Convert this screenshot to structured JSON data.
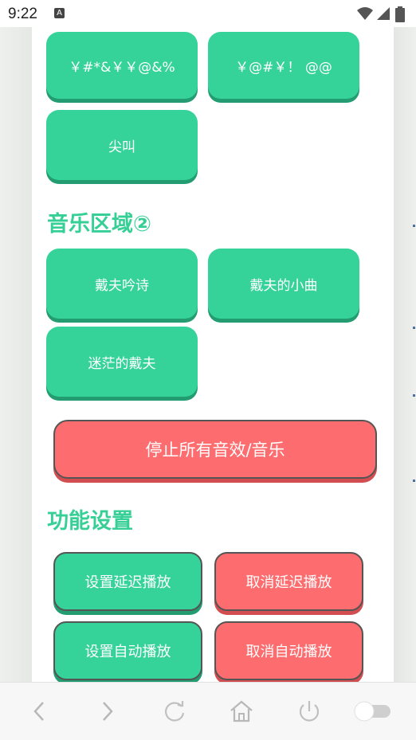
{
  "status_bar": {
    "time": "9:22",
    "notification_icon": "a-icon"
  },
  "effects_buttons": [
    "￥#*&￥￥@&%",
    "￥@#￥！ @@",
    "尖叫"
  ],
  "music_section": {
    "title": "音乐区域②",
    "buttons": [
      "戴夫吟诗",
      "戴夫的小曲",
      "迷茫的戴夫"
    ]
  },
  "stop_all_label": "停止所有音效/音乐",
  "settings_section": {
    "title": "功能设置",
    "set_delay": "设置延迟播放",
    "cancel_delay": "取消延迟播放",
    "set_auto": "设置自动播放",
    "cancel_auto": "取消自动播放"
  },
  "nav_icons": [
    "back-icon",
    "forward-icon",
    "refresh-icon",
    "home-icon",
    "power-icon",
    "toggle-switch"
  ],
  "colors": {
    "accent_green": "#35d399",
    "accent_red": "#fd6c6e",
    "title_green": "#36cf96"
  }
}
